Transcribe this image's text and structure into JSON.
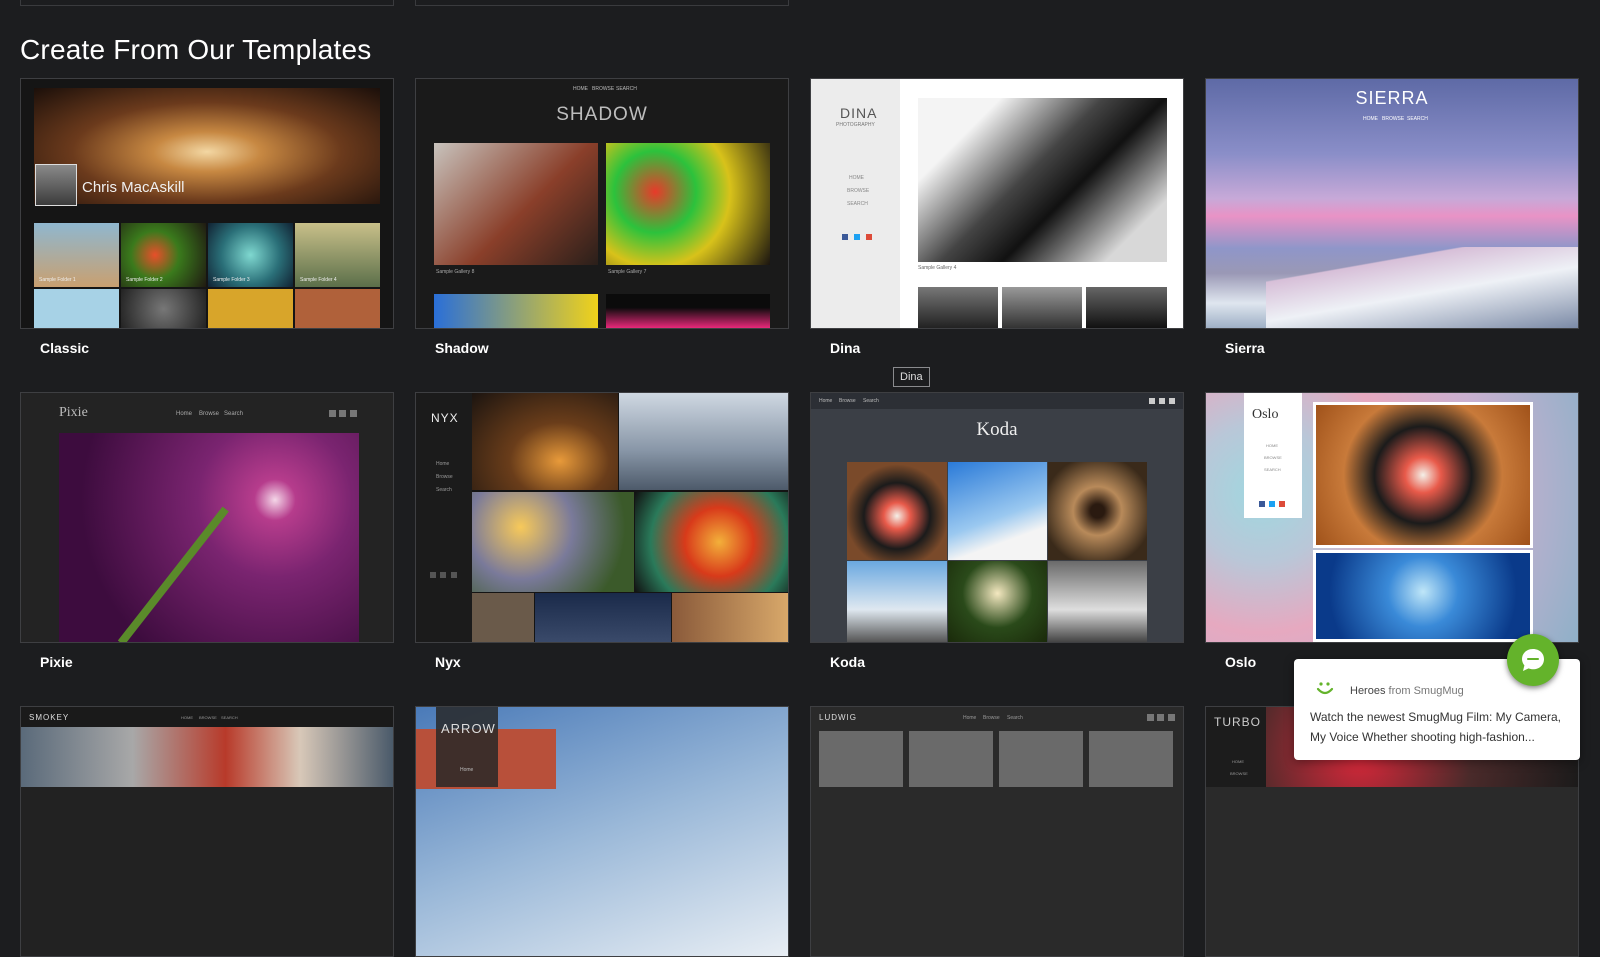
{
  "section": {
    "title": "Create From Our Templates"
  },
  "templates": [
    {
      "name": "Classic",
      "preview": {
        "owner": "Chris MacAskill",
        "folders": [
          "Sample Folder 1",
          "Sample Folder 2",
          "Sample Folder 3",
          "Sample Folder 4"
        ]
      }
    },
    {
      "name": "Shadow",
      "preview": {
        "nav": [
          "HOME",
          "BROWSE",
          "SEARCH"
        ],
        "heading": "SHADOW",
        "galleries": [
          "Sample Gallery 8",
          "Sample Gallery 7"
        ]
      }
    },
    {
      "name": "Dina",
      "preview": {
        "heading": "DINA",
        "subheading": "PHOTOGRAPHY",
        "nav": [
          "HOME",
          "BROWSE",
          "SEARCH"
        ],
        "gallery": "Sample Gallery 4"
      }
    },
    {
      "name": "Sierra",
      "preview": {
        "heading": "SIERRA",
        "nav": [
          "HOME",
          "BROWSE",
          "SEARCH"
        ]
      }
    },
    {
      "name": "Pixie",
      "preview": {
        "heading": "Pixie",
        "nav": [
          "Home",
          "Browse",
          "Search"
        ]
      }
    },
    {
      "name": "Nyx",
      "preview": {
        "heading": "NYX",
        "nav": [
          "Home",
          "Browse",
          "Search"
        ]
      }
    },
    {
      "name": "Koda",
      "preview": {
        "heading": "Koda",
        "nav": [
          "Home",
          "Browse",
          "Search"
        ]
      }
    },
    {
      "name": "Oslo",
      "preview": {
        "heading": "Oslo",
        "nav": [
          "HOME",
          "BROWSE",
          "SEARCH"
        ]
      }
    },
    {
      "preview": {
        "heading": "SMOKEY",
        "nav": [
          "HOME",
          "BROWSE",
          "SEARCH"
        ]
      }
    },
    {
      "preview": {
        "heading": "ARROW",
        "nav": [
          "Home"
        ]
      }
    },
    {
      "preview": {
        "heading": "LUDWIG",
        "nav": [
          "Home",
          "Browse",
          "Search"
        ]
      }
    },
    {
      "preview": {
        "heading": "TURBO",
        "nav": [
          "HOME",
          "BROWSE"
        ]
      }
    }
  ],
  "tooltip": {
    "text": "Dina"
  },
  "chat": {
    "sender": "Heroes",
    "sender_suffix": "from SmugMug",
    "message": "Watch the newest SmugMug Film: My Camera, My Voice Whether shooting high-fashion..."
  },
  "colors": {
    "background": "#1c1d1f",
    "chat_accent": "#64b32b",
    "border": "#3e3f42"
  }
}
